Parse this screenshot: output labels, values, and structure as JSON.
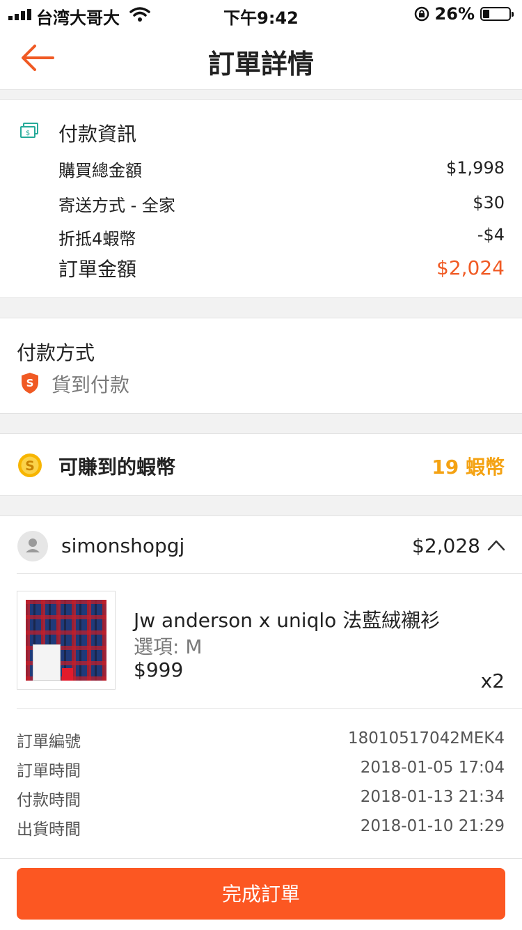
{
  "status_bar": {
    "carrier": "台湾大哥大",
    "time": "下午9:42",
    "battery": "26%",
    "battery_level": 0.26
  },
  "nav": {
    "title": "訂單詳情",
    "back_icon": "back-arrow-icon"
  },
  "payment_info": {
    "title": "付款資訊",
    "icon": "money-icon",
    "rows": [
      {
        "label": "購買總金額",
        "value": "$1,998"
      },
      {
        "label": "寄送方式 - 全家",
        "value": "$30"
      },
      {
        "label": "折抵4蝦幣",
        "value": "-$4"
      }
    ],
    "total_label": "訂單金額",
    "total_value": "$2,024"
  },
  "payment_method": {
    "title": "付款方式",
    "method": "貨到付款",
    "icon": "shopee-shield-icon"
  },
  "coins": {
    "label": "可賺到的蝦幣",
    "value": "19 蝦幣",
    "icon": "coin-icon"
  },
  "shop": {
    "name": "simonshopgj",
    "total": "$2,028",
    "chevron_icon": "chevron-up-icon"
  },
  "product": {
    "name": "Jw anderson x uniqlo 法藍絨襯衫",
    "option": "選項: M",
    "price": "$999",
    "qty": "x2"
  },
  "details": [
    {
      "label": "訂單編號",
      "value": "18010517042MEK4"
    },
    {
      "label": "訂單時間",
      "value": "2018-01-05 17:04"
    },
    {
      "label": "付款時間",
      "value": "2018-01-13 21:34"
    },
    {
      "label": "出貨時間",
      "value": "2018-01-10 21:29"
    }
  ],
  "action": {
    "complete_label": "完成訂單"
  },
  "colors": {
    "accent": "#f05a24",
    "button": "#fc5722",
    "coin": "#f4a212",
    "money_icon": "#26aa99"
  }
}
